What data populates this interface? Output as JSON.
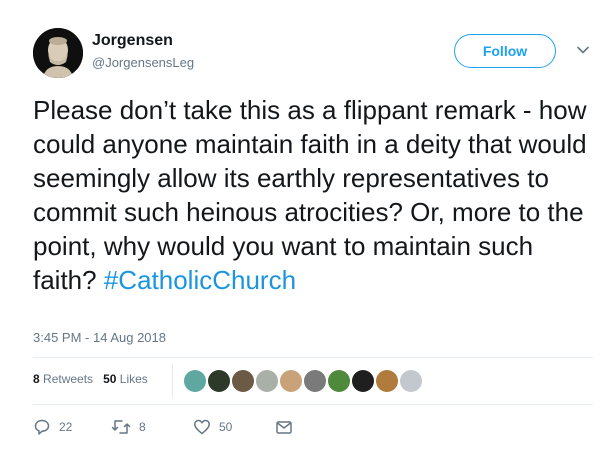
{
  "user": {
    "name": "Jorgensen",
    "handle": "@JorgensensLeg",
    "avatar_icon": "bust-statue-avatar"
  },
  "follow_button": {
    "label": "Follow",
    "color": "#1da1f2"
  },
  "menu_icon": "chevron-down-icon",
  "tweet": {
    "text": "Please don’t take this as a flippant remark - how could anyone maintain faith in a deity that would seemingly allow its earthly representatives to commit such heinous atrocities? Or, more to the point, why would you want to maintain such faith?",
    "hashtag": "#CatholicChurch",
    "hashtag_color": "#1b95e0",
    "timestamp": "3:45 PM - 14 Aug 2018"
  },
  "stats": {
    "retweets_count": "8",
    "retweets_label": "Retweets",
    "likes_count": "50",
    "likes_label": "Likes"
  },
  "likers": [
    {
      "name": "liker-avatar-1",
      "color": "#5fa8a0"
    },
    {
      "name": "liker-avatar-2",
      "color": "#2d3a2a"
    },
    {
      "name": "liker-avatar-3",
      "color": "#6b5a44"
    },
    {
      "name": "liker-avatar-4",
      "color": "#a9b0a8"
    },
    {
      "name": "liker-avatar-5",
      "color": "#c9a27a"
    },
    {
      "name": "liker-avatar-6",
      "color": "#7a7a7a"
    },
    {
      "name": "liker-avatar-7",
      "color": "#4f8a3c"
    },
    {
      "name": "liker-avatar-8",
      "color": "#1f1f1f"
    },
    {
      "name": "liker-avatar-9",
      "color": "#b07b3c"
    },
    {
      "name": "liker-avatar-10",
      "color": "#c2c8ce"
    }
  ],
  "actions": {
    "reply_count": "22",
    "retweet_count": "8",
    "like_count": "50"
  },
  "colors": {
    "text": "#14171a",
    "secondary": "#657786",
    "divider": "#e6ecf0"
  }
}
